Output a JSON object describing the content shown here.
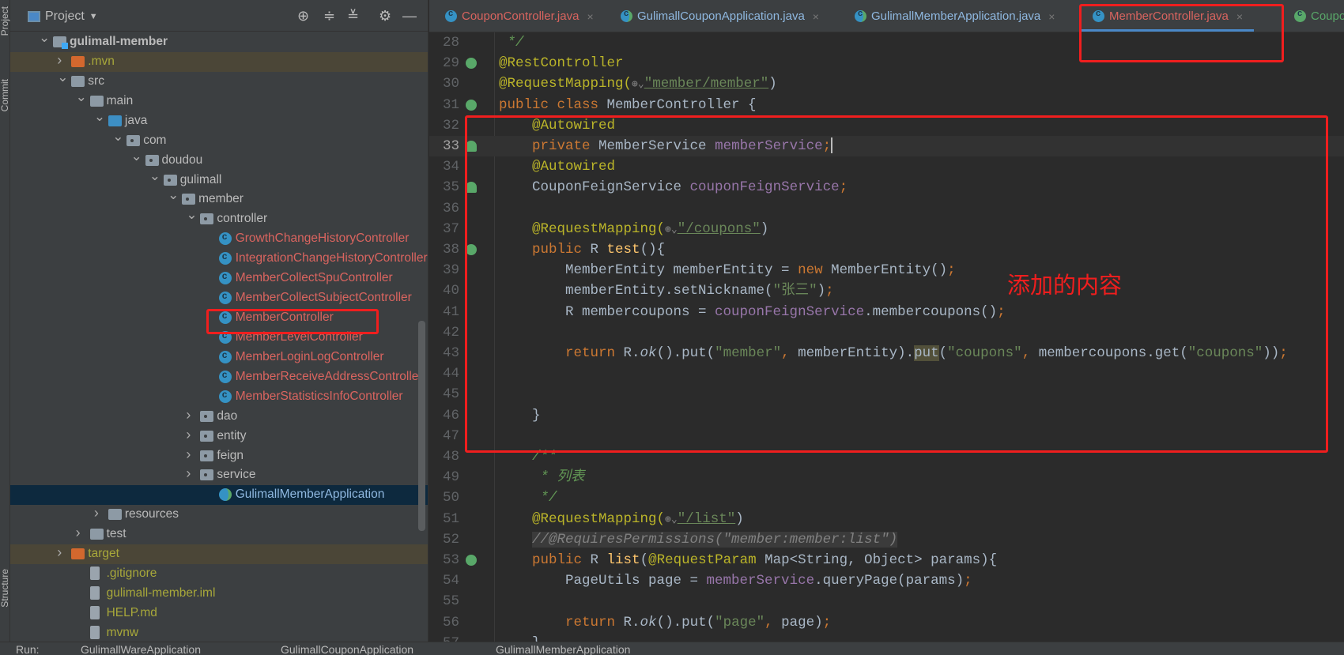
{
  "side_strip": {
    "project": "Project",
    "commit": "Commit",
    "structure": "Structure"
  },
  "project_panel": {
    "title": "Project",
    "tree": [
      {
        "label": "gulimall-member",
        "level": 0,
        "chevron": "open",
        "icon": "module",
        "color": "#bbbbbb",
        "bold": true
      },
      {
        "label": ".mvn",
        "level": 1,
        "chevron": "closed",
        "icon": "orange",
        "color": "#a8a83a",
        "bg": "#4b4637"
      },
      {
        "label": "src",
        "level": 1,
        "chevron": "open",
        "icon": "folder",
        "color": "#bbbbbb"
      },
      {
        "label": "main",
        "level": 2,
        "chevron": "open",
        "icon": "folder",
        "color": "#bbbbbb"
      },
      {
        "label": "java",
        "level": 3,
        "chevron": "open",
        "icon": "blue",
        "color": "#bbbbbb"
      },
      {
        "label": "com",
        "level": 4,
        "chevron": "open",
        "icon": "pkg",
        "color": "#bbbbbb"
      },
      {
        "label": "doudou",
        "level": 5,
        "chevron": "open",
        "icon": "pkg",
        "color": "#bbbbbb"
      },
      {
        "label": "gulimall",
        "level": 6,
        "chevron": "open",
        "icon": "pkg",
        "color": "#bbbbbb"
      },
      {
        "label": "member",
        "level": 7,
        "chevron": "open",
        "icon": "pkg",
        "color": "#bbbbbb"
      },
      {
        "label": "controller",
        "level": 8,
        "chevron": "open",
        "icon": "pkg",
        "color": "#bbbbbb"
      },
      {
        "label": "GrowthChangeHistoryController",
        "level": 9,
        "icon": "cls",
        "color": "#d9645f"
      },
      {
        "label": "IntegrationChangeHistoryController",
        "level": 9,
        "icon": "cls",
        "color": "#d9645f"
      },
      {
        "label": "MemberCollectSpuController",
        "level": 9,
        "icon": "cls",
        "color": "#d9645f"
      },
      {
        "label": "MemberCollectSubjectController",
        "level": 9,
        "icon": "cls",
        "color": "#d9645f"
      },
      {
        "label": "MemberController",
        "level": 9,
        "icon": "cls",
        "color": "#d9645f"
      },
      {
        "label": "MemberLevelController",
        "level": 9,
        "icon": "cls",
        "color": "#d9645f"
      },
      {
        "label": "MemberLoginLogController",
        "level": 9,
        "icon": "cls",
        "color": "#d9645f"
      },
      {
        "label": "MemberReceiveAddressController",
        "level": 9,
        "icon": "cls",
        "color": "#d9645f"
      },
      {
        "label": "MemberStatisticsInfoController",
        "level": 9,
        "icon": "cls",
        "color": "#d9645f"
      },
      {
        "label": "dao",
        "level": 8,
        "chevron": "closed",
        "icon": "pkg",
        "color": "#bbbbbb"
      },
      {
        "label": "entity",
        "level": 8,
        "chevron": "closed",
        "icon": "pkg",
        "color": "#bbbbbb"
      },
      {
        "label": "feign",
        "level": 8,
        "chevron": "closed",
        "icon": "pkg",
        "color": "#bbbbbb"
      },
      {
        "label": "service",
        "level": 8,
        "chevron": "closed",
        "icon": "pkg",
        "color": "#bbbbbb"
      },
      {
        "label": "GulimallMemberApplication",
        "level": 9,
        "icon": "app",
        "color": "#8fb8e0",
        "bg": "#0d293e",
        "selected": true
      },
      {
        "label": "resources",
        "level": 3,
        "chevron": "closed",
        "icon": "folder",
        "color": "#bbbbbb"
      },
      {
        "label": "test",
        "level": 2,
        "chevron": "closed",
        "icon": "folder",
        "color": "#bbbbbb"
      },
      {
        "label": "target",
        "level": 1,
        "chevron": "closed",
        "icon": "orange",
        "color": "#a8a83a",
        "bg": "#4b4637"
      },
      {
        "label": ".gitignore",
        "level": 2,
        "icon": "file",
        "color": "#a8a83a"
      },
      {
        "label": "gulimall-member.iml",
        "level": 2,
        "icon": "file",
        "color": "#a8a83a"
      },
      {
        "label": "HELP.md",
        "level": 2,
        "icon": "file",
        "color": "#a8a83a"
      },
      {
        "label": "mvnw",
        "level": 2,
        "icon": "file",
        "color": "#a8a83a"
      }
    ]
  },
  "tabs": [
    {
      "label": "CouponController.java",
      "color": "#d9645f",
      "icon": "class"
    },
    {
      "label": "GulimallCouponApplication.java",
      "color": "#8fb8e0",
      "icon": "app"
    },
    {
      "label": "GulimallMemberApplication.java",
      "color": "#8fb8e0",
      "icon": "app"
    },
    {
      "label": "MemberController.java",
      "color": "#d9645f",
      "icon": "class",
      "active": true
    },
    {
      "label": "CouponF",
      "color": "#59a869",
      "icon": "interface"
    }
  ],
  "tab_close": "×",
  "editor": {
    "lines": [
      {
        "n": "28",
        "t": [
          [
            " */",
            "cm"
          ]
        ]
      },
      {
        "n": "29",
        "g": "bean",
        "t": [
          [
            "@RestController",
            "an"
          ]
        ]
      },
      {
        "n": "30",
        "t": [
          [
            "@RequestMapping(",
            "an"
          ],
          [
            "⊕⌄",
            "ic"
          ],
          [
            "\"member/member\"",
            "su"
          ],
          [
            ")",
            "df"
          ]
        ]
      },
      {
        "n": "31",
        "g": "bean",
        "t": [
          [
            "public class ",
            "kw"
          ],
          [
            "MemberController {",
            "df"
          ]
        ]
      },
      {
        "n": "32",
        "t": [
          [
            "    ",
            "df"
          ],
          [
            "@Autowired",
            "an"
          ]
        ]
      },
      {
        "n": "33",
        "g": "arrow",
        "cur": true,
        "t": [
          [
            "    ",
            "df"
          ],
          [
            "private ",
            "kw"
          ],
          [
            "MemberService ",
            "df"
          ],
          [
            "memberService",
            "fd"
          ],
          [
            ";",
            "kw"
          ]
        ]
      },
      {
        "n": "34",
        "t": [
          [
            "    ",
            "df"
          ],
          [
            "@Autowired",
            "an"
          ]
        ]
      },
      {
        "n": "35",
        "g": "arrow",
        "t": [
          [
            "    CouponFeignService ",
            "df"
          ],
          [
            "couponFeignService",
            "fd"
          ],
          [
            ";",
            "kw"
          ]
        ]
      },
      {
        "n": "36",
        "t": []
      },
      {
        "n": "37",
        "t": [
          [
            "    @RequestMapping(",
            "an"
          ],
          [
            "⊕⌄",
            "ic"
          ],
          [
            "\"/coupons\"",
            "su"
          ],
          [
            ")",
            "df"
          ]
        ]
      },
      {
        "n": "38",
        "g": "web",
        "t": [
          [
            "    public ",
            "kw"
          ],
          [
            "R ",
            "df"
          ],
          [
            "test",
            "md"
          ],
          [
            "(){",
            "df"
          ]
        ]
      },
      {
        "n": "39",
        "t": [
          [
            "        MemberEntity memberEntity = ",
            "df"
          ],
          [
            "new ",
            "kw"
          ],
          [
            "MemberEntity()",
            "df"
          ],
          [
            ";",
            "kw"
          ]
        ]
      },
      {
        "n": "40",
        "t": [
          [
            "        memberEntity.setNickname(",
            "df"
          ],
          [
            "\"张三\"",
            "st"
          ],
          [
            ")",
            "df"
          ],
          [
            ";",
            "kw"
          ]
        ]
      },
      {
        "n": "41",
        "t": [
          [
            "        R membercoupons = ",
            "df"
          ],
          [
            "couponFeignService",
            "fd"
          ],
          [
            ".membercoupons()",
            "df"
          ],
          [
            ";",
            "kw"
          ]
        ]
      },
      {
        "n": "42",
        "t": []
      },
      {
        "n": "43",
        "t": [
          [
            "        return ",
            "kw"
          ],
          [
            "R.",
            "df"
          ],
          [
            "ok",
            "it"
          ],
          [
            "().put(",
            "df"
          ],
          [
            "\"member\"",
            "st"
          ],
          [
            ", ",
            "kw"
          ],
          [
            "memberEntity).",
            "df"
          ],
          [
            "put",
            "hl"
          ],
          [
            "(",
            "df"
          ],
          [
            "\"coupons\"",
            "st"
          ],
          [
            ", ",
            "kw"
          ],
          [
            "membercoupons.get(",
            "df"
          ],
          [
            "\"coupons\"",
            "st"
          ],
          [
            "))",
            "df"
          ],
          [
            ";",
            "kw"
          ]
        ]
      },
      {
        "n": "44",
        "t": []
      },
      {
        "n": "45",
        "t": []
      },
      {
        "n": "46",
        "t": [
          [
            "    }",
            "df"
          ]
        ]
      },
      {
        "n": "47",
        "t": []
      },
      {
        "n": "48",
        "t": [
          [
            "    /**",
            "cm"
          ]
        ]
      },
      {
        "n": "49",
        "t": [
          [
            "     * 列表",
            "cm"
          ]
        ]
      },
      {
        "n": "50",
        "t": [
          [
            "     */",
            "cm"
          ]
        ]
      },
      {
        "n": "51",
        "t": [
          [
            "    @RequestMapping(",
            "an"
          ],
          [
            "⊕⌄",
            "ic"
          ],
          [
            "\"/list\"",
            "su"
          ],
          [
            ")",
            "df"
          ]
        ]
      },
      {
        "n": "52",
        "t": [
          [
            "    ",
            "df"
          ],
          [
            "//@RequiresPermissions(\"member:member:list\")",
            "lc"
          ]
        ]
      },
      {
        "n": "53",
        "g": "web",
        "t": [
          [
            "    public ",
            "kw"
          ],
          [
            "R ",
            "df"
          ],
          [
            "list",
            "md"
          ],
          [
            "(",
            "df"
          ],
          [
            "@RequestParam ",
            "an"
          ],
          [
            "Map<String, Object> params){",
            "df"
          ]
        ]
      },
      {
        "n": "54",
        "t": [
          [
            "        PageUtils page = ",
            "df"
          ],
          [
            "memberService",
            "fd"
          ],
          [
            ".queryPage(params)",
            "df"
          ],
          [
            ";",
            "kw"
          ]
        ]
      },
      {
        "n": "55",
        "t": []
      },
      {
        "n": "56",
        "t": [
          [
            "        return ",
            "kw"
          ],
          [
            "R.",
            "df"
          ],
          [
            "ok",
            "it"
          ],
          [
            "().put(",
            "df"
          ],
          [
            "\"page\"",
            "st"
          ],
          [
            ", ",
            "kw"
          ],
          [
            "page)",
            "df"
          ],
          [
            ";",
            "kw"
          ]
        ]
      },
      {
        "n": "57",
        "t": [
          [
            "    }",
            "df"
          ]
        ]
      }
    ]
  },
  "annotation": {
    "note": "添加的内容",
    "color": "#f01e1e"
  },
  "run_bar": {
    "label": "Run:",
    "items": [
      "GulimallWareApplication",
      "GulimallCouponApplication",
      "GulimallMemberApplication"
    ]
  }
}
